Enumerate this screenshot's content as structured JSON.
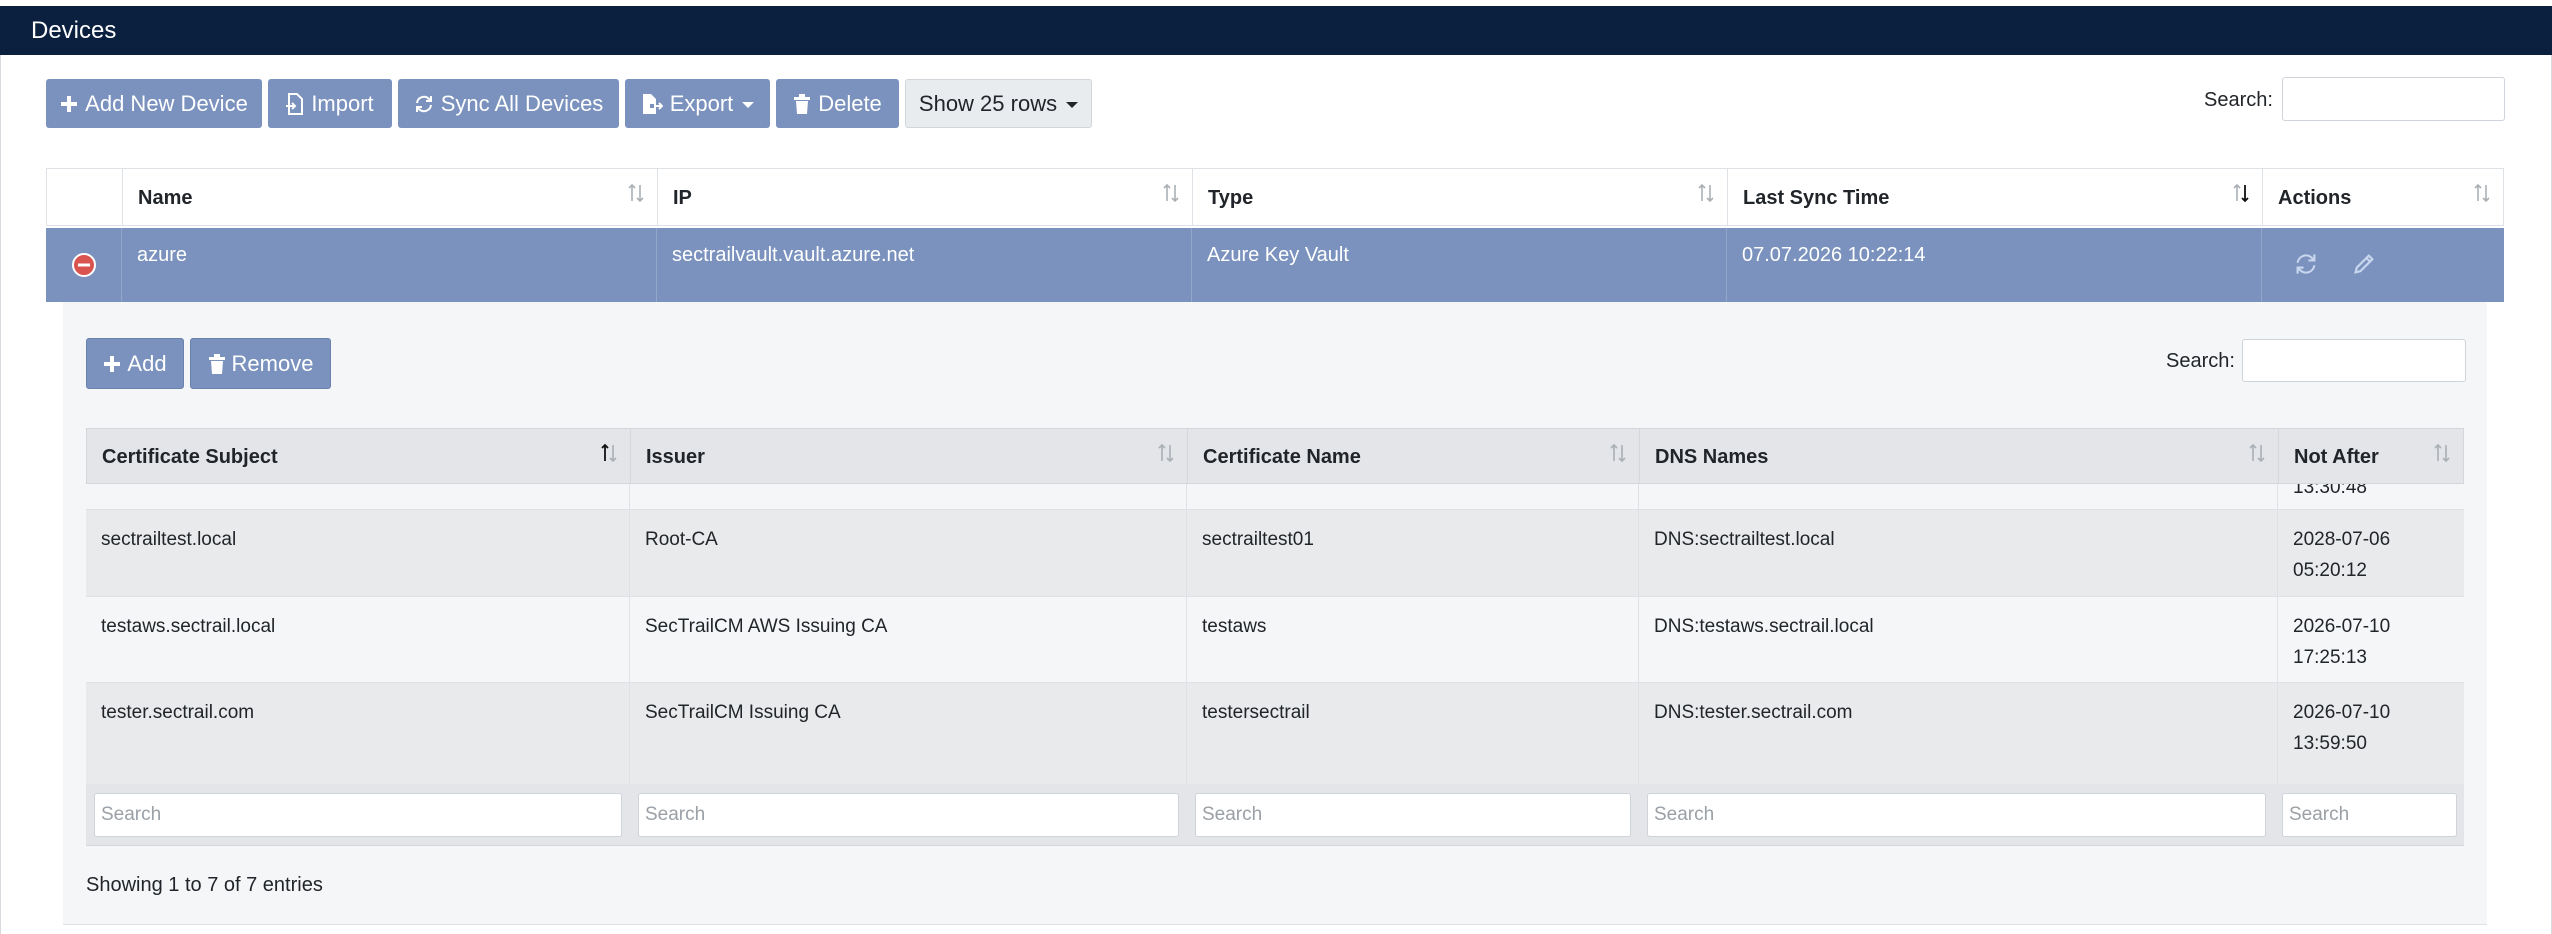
{
  "header": {
    "title": "Devices"
  },
  "toolbar": {
    "add_label": "Add New Device",
    "import_label": "Import",
    "sync_label": "Sync All Devices",
    "export_label": "Export",
    "delete_label": "Delete",
    "rows_label": "Show 25 rows"
  },
  "search": {
    "label": "Search:"
  },
  "devices_table": {
    "columns": [
      "Name",
      "IP",
      "Type",
      "Last Sync Time",
      "Actions"
    ],
    "rows": [
      {
        "name": "azure",
        "ip": "sectrailvault.vault.azure.net",
        "type": "Azure Key Vault",
        "last_sync": "07.07.2026 10:22:14"
      }
    ]
  },
  "child": {
    "add_label": "Add",
    "remove_label": "Remove",
    "search_label": "Search:",
    "columns": [
      "Certificate Subject",
      "Issuer",
      "Certificate Name",
      "DNS Names",
      "Not After"
    ],
    "partial_row": {
      "not_after": "13:30:48"
    },
    "rows": [
      {
        "subject": "sectrailtest.local",
        "issuer": "Root-CA",
        "cert_name": "sectrailtest01",
        "dns": "DNS:sectrailtest.local",
        "not_after_date": "2028-07-06",
        "not_after_time": "05:20:12"
      },
      {
        "subject": "testaws.sectrail.local",
        "issuer": "SecTrailCM AWS Issuing CA",
        "cert_name": "testaws",
        "dns": "DNS:testaws.sectrail.local",
        "not_after_date": "2026-07-10",
        "not_after_time": "17:25:13"
      },
      {
        "subject": "tester.sectrail.com",
        "issuer": "SecTrailCM Issuing CA",
        "cert_name": "testersectrail",
        "dns": "DNS:tester.sectrail.com",
        "not_after_date": "2026-07-10",
        "not_after_time": "13:59:50"
      }
    ],
    "filter_placeholder": "Search",
    "info": "Showing 1 to 7 of 7 entries"
  },
  "colors": {
    "header_bg": "#0b1f3e",
    "accent": "#7a92bd",
    "delete_icon": "#d9534f"
  }
}
